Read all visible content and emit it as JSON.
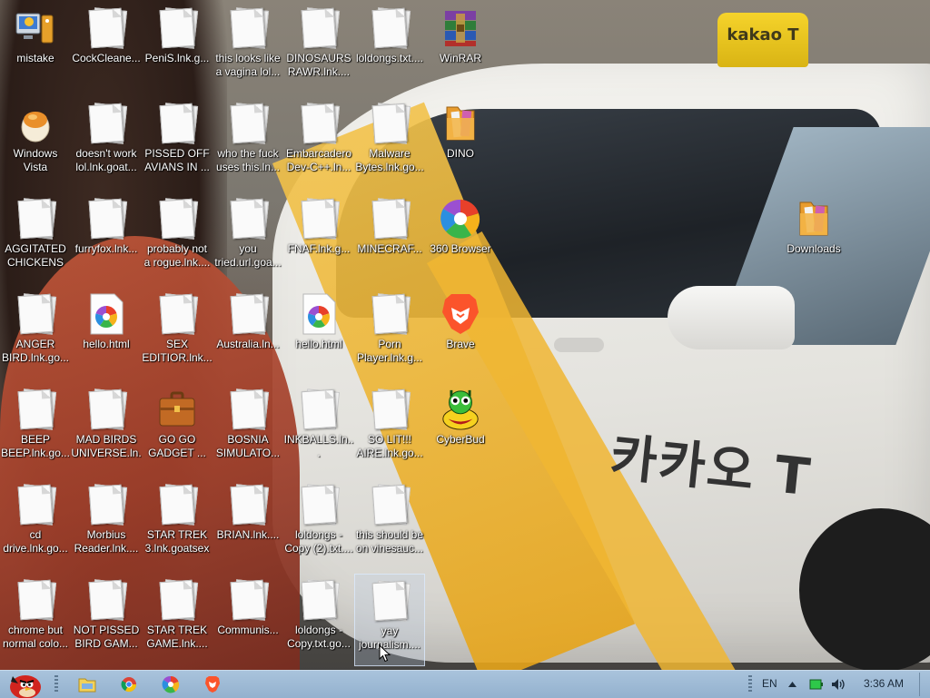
{
  "wallpaper": {
    "taxi_sign_text": "kakao T",
    "car_door_text": "카카오 T"
  },
  "desktop_icons": [
    {
      "name": "icon-mistake",
      "label": "mistake",
      "icon": "computer-figure-icon",
      "col": 0,
      "row": 0
    },
    {
      "name": "icon-cockcleaner",
      "label": "CockCleane...",
      "icon": "document-icon",
      "col": 1,
      "row": 0
    },
    {
      "name": "icon-penis-lnk",
      "label": "PeniS.lnk.g...",
      "icon": "document-icon",
      "col": 2,
      "row": 0
    },
    {
      "name": "icon-this-looks-like",
      "label": "this looks like\na vagina lol...",
      "icon": "document-icon",
      "col": 3,
      "row": 0
    },
    {
      "name": "icon-dinosaurs-rawr",
      "label": "DINOSAURS\nRAWR.lnk....",
      "icon": "document-icon",
      "col": 4,
      "row": 0
    },
    {
      "name": "icon-loldongs-txt",
      "label": "loldongs.txt....",
      "icon": "document-icon",
      "col": 5,
      "row": 0
    },
    {
      "name": "icon-winrar",
      "label": "WinRAR",
      "icon": "winrar-icon",
      "col": 6,
      "row": 0
    },
    {
      "name": "icon-windows-vista",
      "label": "Windows\nVista",
      "icon": "vista-egg-icon",
      "col": 0,
      "row": 1
    },
    {
      "name": "icon-doesnt-work",
      "label": "doesn't work\nlol.lnk.goat...",
      "icon": "document-icon",
      "col": 1,
      "row": 1
    },
    {
      "name": "icon-pissed-off-avians",
      "label": "PISSED OFF\nAVIANS IN ...",
      "icon": "document-icon",
      "col": 2,
      "row": 1
    },
    {
      "name": "icon-who-the-fuck",
      "label": "who the fuck\nuses this.ln...",
      "icon": "document-icon",
      "col": 3,
      "row": 1
    },
    {
      "name": "icon-embarcadero",
      "label": "Embarcadero\nDev-C++.ln...",
      "icon": "document-icon",
      "col": 4,
      "row": 1
    },
    {
      "name": "icon-malware-bytes",
      "label": "Malware\nBytes.lnk.go...",
      "icon": "document-icon",
      "col": 5,
      "row": 1
    },
    {
      "name": "icon-dino-folder",
      "label": "DINO",
      "icon": "folder-icon",
      "col": 6,
      "row": 1
    },
    {
      "name": "icon-aggitated-chickens",
      "label": "AGGITATED\nCHICKENS I...",
      "icon": "document-icon",
      "col": 0,
      "row": 2
    },
    {
      "name": "icon-furryfox",
      "label": "furryfox.lnk...",
      "icon": "document-icon",
      "col": 1,
      "row": 2
    },
    {
      "name": "icon-probably-not-rogue",
      "label": "probably not\na rogue.lnk....",
      "icon": "document-icon",
      "col": 2,
      "row": 2
    },
    {
      "name": "icon-you-tried",
      "label": "you\ntried.url.goa...",
      "icon": "document-icon",
      "col": 3,
      "row": 2
    },
    {
      "name": "icon-fnaf",
      "label": "FNAF.lnk.g...",
      "icon": "document-icon",
      "col": 4,
      "row": 2
    },
    {
      "name": "icon-minecraft",
      "label": "MINECRAF...",
      "icon": "document-icon",
      "col": 5,
      "row": 2
    },
    {
      "name": "icon-360-browser",
      "label": "360 Browser",
      "icon": "360-browser-icon",
      "col": 6,
      "row": 2
    },
    {
      "name": "icon-anger-bird",
      "label": "ANGER\nBIRD.lnk.go...",
      "icon": "document-icon",
      "col": 0,
      "row": 3
    },
    {
      "name": "icon-hello-html-1",
      "label": "hello.html",
      "icon": "html-file-icon",
      "col": 1,
      "row": 3
    },
    {
      "name": "icon-sex-editior",
      "label": "SEX\nEDITIOR.lnk...",
      "icon": "document-icon",
      "col": 2,
      "row": 3
    },
    {
      "name": "icon-australia",
      "label": "Australia.ln...",
      "icon": "document-icon",
      "col": 3,
      "row": 3
    },
    {
      "name": "icon-hello-html-2",
      "label": "hello.html",
      "icon": "html-file-icon",
      "col": 4,
      "row": 3
    },
    {
      "name": "icon-porn-player",
      "label": "Porn\nPlayer.lnk.g...",
      "icon": "document-icon",
      "col": 5,
      "row": 3
    },
    {
      "name": "icon-brave",
      "label": "Brave",
      "icon": "brave-lion-icon",
      "col": 6,
      "row": 3
    },
    {
      "name": "icon-beep-beep",
      "label": "BEEP\nBEEP.lnk.go...",
      "icon": "document-icon",
      "col": 0,
      "row": 4
    },
    {
      "name": "icon-mad-birds-universe",
      "label": "MAD BIRDS\nUNIVERSE.ln...",
      "icon": "document-icon",
      "col": 1,
      "row": 4
    },
    {
      "name": "icon-go-go-gadget",
      "label": "GO GO\nGADGET ...",
      "icon": "briefcase-icon",
      "col": 2,
      "row": 4
    },
    {
      "name": "icon-bosnia-simulator",
      "label": "BOSNIA\nSIMULATO...",
      "icon": "document-icon",
      "col": 3,
      "row": 4
    },
    {
      "name": "icon-inkballs",
      "label": "INKBALLS.ln...",
      "icon": "document-icon",
      "col": 4,
      "row": 4
    },
    {
      "name": "icon-so-lit-aire",
      "label": "SO LIT!!!\nAIRE.lnk.go...",
      "icon": "document-icon",
      "col": 5,
      "row": 4
    },
    {
      "name": "icon-cyberbud",
      "label": "CyberBud",
      "icon": "cyberbud-icon",
      "col": 6,
      "row": 4
    },
    {
      "name": "icon-cd-drive",
      "label": "cd\ndrive.lnk.go...",
      "icon": "document-icon",
      "col": 0,
      "row": 5
    },
    {
      "name": "icon-morbius-reader",
      "label": "Morbius\nReader.lnk....",
      "icon": "document-icon",
      "col": 1,
      "row": 5
    },
    {
      "name": "icon-star-trek-3",
      "label": "STAR TREK\n3.lnk.goatsex",
      "icon": "document-icon",
      "col": 2,
      "row": 5
    },
    {
      "name": "icon-brian",
      "label": "BRIAN.lnk....",
      "icon": "document-icon",
      "col": 3,
      "row": 5
    },
    {
      "name": "icon-loldongs-copy-2",
      "label": "loldongs -\nCopy (2).txt....",
      "icon": "document-icon",
      "col": 4,
      "row": 5
    },
    {
      "name": "icon-this-should-be-vine",
      "label": "this should be\non vinesauc...",
      "icon": "document-icon",
      "col": 5,
      "row": 5
    },
    {
      "name": "icon-chrome-but-normal",
      "label": "chrome but\nnormal colo...",
      "icon": "document-icon",
      "col": 0,
      "row": 6
    },
    {
      "name": "icon-not-pissed-bird",
      "label": "NOT PISSED\nBIRD GAM...",
      "icon": "document-icon",
      "col": 1,
      "row": 6
    },
    {
      "name": "icon-star-trek-game",
      "label": "STAR TREK\nGAME.lnk....",
      "icon": "document-icon",
      "col": 2,
      "row": 6
    },
    {
      "name": "icon-communis",
      "label": "Communis...",
      "icon": "document-icon",
      "col": 3,
      "row": 6
    },
    {
      "name": "icon-loldongs-copy",
      "label": "loldongs -\nCopy.txt.go...",
      "icon": "document-icon",
      "col": 4,
      "row": 6
    },
    {
      "name": "icon-yay-journalism",
      "label": "yay\njournalism....",
      "icon": "document-icon",
      "col": 5,
      "row": 6,
      "selected": true
    },
    {
      "name": "icon-downloads",
      "label": "Downloads",
      "icon": "folder-icon",
      "col": 11,
      "row": 2,
      "x_override": true
    }
  ],
  "taskbar": {
    "start_icon": "angry-red-bird-icon",
    "pinned": [
      {
        "name": "taskbar-explorer",
        "icon": "folder-explorer-icon"
      },
      {
        "name": "taskbar-chrome",
        "icon": "chrome-icon"
      },
      {
        "name": "taskbar-360-browser",
        "icon": "360-browser-icon"
      },
      {
        "name": "taskbar-brave",
        "icon": "brave-lion-icon"
      }
    ],
    "language": "EN",
    "clock": "3:36 AM"
  }
}
